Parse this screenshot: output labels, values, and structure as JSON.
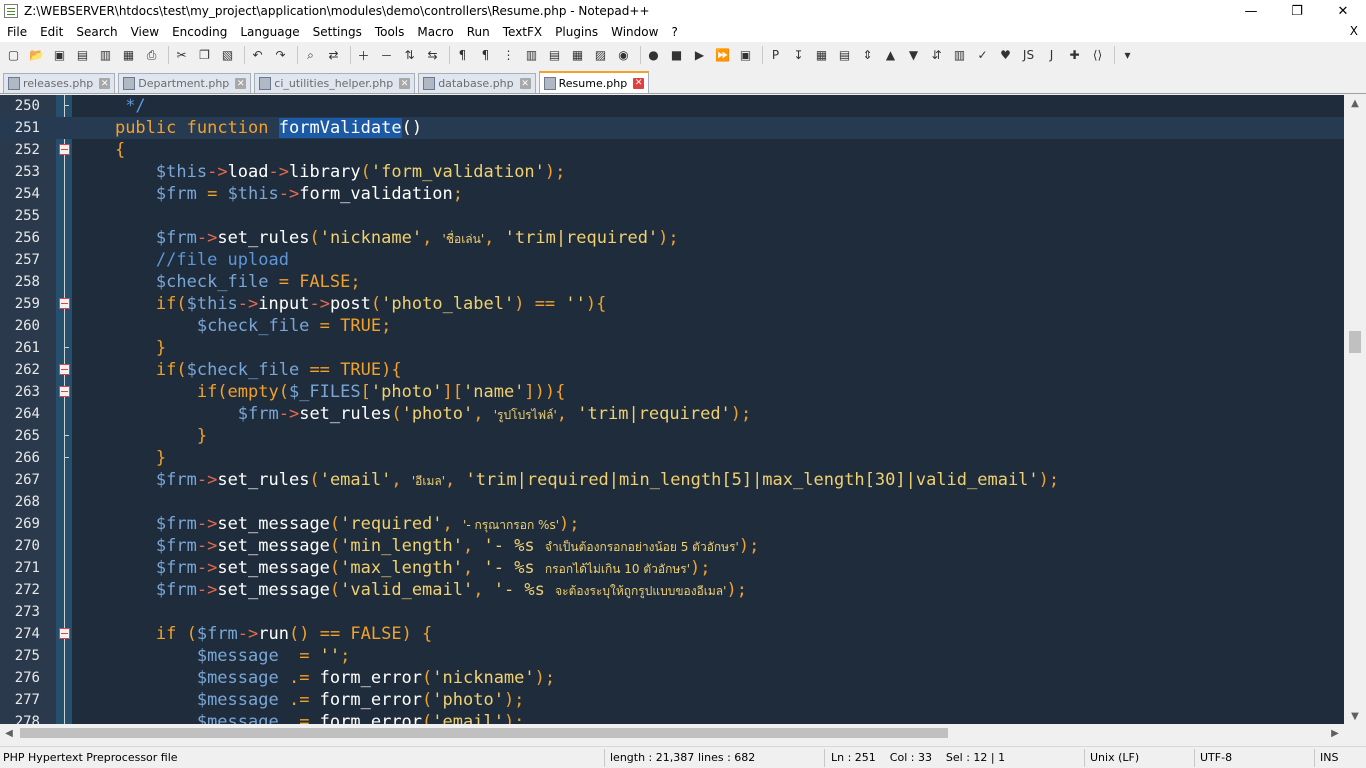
{
  "window": {
    "title": "Z:\\WEBSERVER\\htdocs\\test\\my_project\\application\\modules\\demo\\controllers\\Resume.php - Notepad++",
    "minimize": "—",
    "maximize": "❐",
    "close": "✕"
  },
  "menu": {
    "items": [
      "File",
      "Edit",
      "Search",
      "View",
      "Encoding",
      "Language",
      "Settings",
      "Tools",
      "Macro",
      "Run",
      "TextFX",
      "Plugins",
      "Window",
      "?"
    ],
    "close": "X"
  },
  "toolbar": {
    "icons": [
      "new-file-icon",
      "open-file-icon",
      "save-icon",
      "save-all-icon",
      "close-icon",
      "close-all-icon",
      "print-icon",
      "cut-icon",
      "copy-icon",
      "paste-icon",
      "undo-icon",
      "redo-icon",
      "find-icon",
      "replace-icon",
      "zoom-in-icon",
      "zoom-out-icon",
      "sync-vertical-icon",
      "sync-horizontal-icon",
      "word-wrap-icon",
      "show-all-chars-icon",
      "indent-guide-icon",
      "udl-icon",
      "doc-map-icon",
      "function-list-icon",
      "folder-workspace-icon",
      "monitor-icon",
      "record-macro-icon",
      "stop-record-icon",
      "play-macro-icon",
      "run-macro-multiple-icon",
      "save-macro-icon",
      "php-icon",
      "insert-icon",
      "table-icon",
      "list-icon",
      "sort-icon",
      "up-arrow-icon",
      "down-arrow-icon",
      "compare-icon",
      "split-icon",
      "spell-check-icon",
      "heart-icon",
      "js-icon",
      "json-icon",
      "plugin-icon",
      "xml-icon",
      "dropdown-icon"
    ],
    "glyphs": [
      "▢",
      "📂",
      "▣",
      "▤",
      "▥",
      "▦",
      "⎙",
      "✂",
      "❐",
      "▧",
      "↶",
      "↷",
      "⌕",
      "⇄",
      "＋",
      "－",
      "⇅",
      "⇆",
      "¶",
      "¶",
      "⋮",
      "▥",
      "▤",
      "▦",
      "▨",
      "◉",
      "●",
      "■",
      "▶",
      "⏩",
      "▣",
      "P",
      "↧",
      "▦",
      "▤",
      "⇕",
      "▲",
      "▼",
      "⇵",
      "▥",
      "✓",
      "♥",
      "JS",
      "J",
      "✚",
      "⟨⟩",
      "▾"
    ]
  },
  "tabs": [
    {
      "label": "releases.php",
      "active": false
    },
    {
      "label": "Department.php",
      "active": false
    },
    {
      "label": "ci_utilities_helper.php",
      "active": false
    },
    {
      "label": "database.php",
      "active": false
    },
    {
      "label": "Resume.php",
      "active": true
    }
  ],
  "tab_close_glyph": "✕",
  "editor": {
    "current_line": 251,
    "lines": [
      {
        "n": "250",
        "fold": "tick",
        "indent": "    ",
        "tokens": [
          [
            "cmt",
            " */"
          ]
        ]
      },
      {
        "n": "251",
        "fold": "none",
        "indent": "    ",
        "tokens": [
          [
            "kw",
            "public"
          ],
          [
            "",
            " "
          ],
          [
            "kw",
            "function"
          ],
          [
            "",
            " "
          ],
          [
            "hl",
            "formValidate"
          ],
          [
            "fn",
            "()"
          ]
        ]
      },
      {
        "n": "252",
        "fold": "box",
        "indent": "    ",
        "tokens": [
          [
            "kw",
            "{"
          ]
        ]
      },
      {
        "n": "253",
        "fold": "none",
        "indent": "        ",
        "tokens": [
          [
            "var",
            "$this"
          ],
          [
            "op",
            "->"
          ],
          [
            "fn",
            "load"
          ],
          [
            "op",
            "->"
          ],
          [
            "fn",
            "library"
          ],
          [
            "kw",
            "("
          ],
          [
            "str",
            "'form_validation'"
          ],
          [
            "kw",
            ");"
          ]
        ]
      },
      {
        "n": "254",
        "fold": "none",
        "indent": "        ",
        "tokens": [
          [
            "var",
            "$frm"
          ],
          [
            "kw",
            " = "
          ],
          [
            "var",
            "$this"
          ],
          [
            "op",
            "->"
          ],
          [
            "fn",
            "form_validation"
          ],
          [
            "kw",
            ";"
          ]
        ]
      },
      {
        "n": "255",
        "fold": "none",
        "indent": "",
        "tokens": []
      },
      {
        "n": "256",
        "fold": "none",
        "indent": "        ",
        "tokens": [
          [
            "var",
            "$frm"
          ],
          [
            "op",
            "->"
          ],
          [
            "fn",
            "set_rules"
          ],
          [
            "kw",
            "("
          ],
          [
            "str",
            "'nickname'"
          ],
          [
            "kw",
            ", "
          ],
          [
            "str thai",
            "'ชื่อเล่น'"
          ],
          [
            "kw",
            ", "
          ],
          [
            "str",
            "'trim|required'"
          ],
          [
            "kw",
            ");"
          ]
        ]
      },
      {
        "n": "257",
        "fold": "none",
        "indent": "        ",
        "tokens": [
          [
            "cmt",
            "//file upload"
          ]
        ]
      },
      {
        "n": "258",
        "fold": "none",
        "indent": "        ",
        "tokens": [
          [
            "var",
            "$check_file"
          ],
          [
            "kw",
            " = FALSE;"
          ]
        ]
      },
      {
        "n": "259",
        "fold": "box",
        "indent": "        ",
        "tokens": [
          [
            "kw",
            "if("
          ],
          [
            "var",
            "$this"
          ],
          [
            "op",
            "->"
          ],
          [
            "fn",
            "input"
          ],
          [
            "op",
            "->"
          ],
          [
            "fn",
            "post"
          ],
          [
            "kw",
            "("
          ],
          [
            "str",
            "'photo_label'"
          ],
          [
            "kw",
            ") == "
          ],
          [
            "str",
            "''"
          ],
          [
            "kw",
            "){"
          ]
        ]
      },
      {
        "n": "260",
        "fold": "none",
        "indent": "            ",
        "tokens": [
          [
            "var",
            "$check_file"
          ],
          [
            "kw",
            " = TRUE;"
          ]
        ]
      },
      {
        "n": "261",
        "fold": "tick",
        "indent": "        ",
        "tokens": [
          [
            "kw",
            "}"
          ]
        ]
      },
      {
        "n": "262",
        "fold": "box",
        "indent": "        ",
        "tokens": [
          [
            "kw",
            "if("
          ],
          [
            "var",
            "$check_file"
          ],
          [
            "kw",
            " == TRUE){"
          ]
        ]
      },
      {
        "n": "263",
        "fold": "box",
        "indent": "            ",
        "tokens": [
          [
            "kw",
            "if(empty("
          ],
          [
            "var",
            "$_FILES"
          ],
          [
            "kw",
            "["
          ],
          [
            "str",
            "'photo'"
          ],
          [
            "kw",
            "]["
          ],
          [
            "str",
            "'name'"
          ],
          [
            "kw",
            "])){"
          ]
        ]
      },
      {
        "n": "264",
        "fold": "none",
        "indent": "                ",
        "tokens": [
          [
            "var",
            "$frm"
          ],
          [
            "op",
            "->"
          ],
          [
            "fn",
            "set_rules"
          ],
          [
            "kw",
            "("
          ],
          [
            "str",
            "'photo'"
          ],
          [
            "kw",
            ", "
          ],
          [
            "str thai",
            "'รูปโปรไฟล์'"
          ],
          [
            "kw",
            ", "
          ],
          [
            "str",
            "'trim|required'"
          ],
          [
            "kw",
            ");"
          ]
        ]
      },
      {
        "n": "265",
        "fold": "tick",
        "indent": "            ",
        "tokens": [
          [
            "kw",
            "}"
          ]
        ]
      },
      {
        "n": "266",
        "fold": "tick",
        "indent": "        ",
        "tokens": [
          [
            "kw",
            "}"
          ]
        ]
      },
      {
        "n": "267",
        "fold": "none",
        "indent": "        ",
        "tokens": [
          [
            "var",
            "$frm"
          ],
          [
            "op",
            "->"
          ],
          [
            "fn",
            "set_rules"
          ],
          [
            "kw",
            "("
          ],
          [
            "str",
            "'email'"
          ],
          [
            "kw",
            ", "
          ],
          [
            "str thai",
            "'อีเมล'"
          ],
          [
            "kw",
            ", "
          ],
          [
            "str",
            "'trim|required|min_length[5]|max_length[30]|valid_email'"
          ],
          [
            "kw",
            ");"
          ]
        ]
      },
      {
        "n": "268",
        "fold": "none",
        "indent": "",
        "tokens": []
      },
      {
        "n": "269",
        "fold": "none",
        "indent": "        ",
        "tokens": [
          [
            "var",
            "$frm"
          ],
          [
            "op",
            "->"
          ],
          [
            "fn",
            "set_message"
          ],
          [
            "kw",
            "("
          ],
          [
            "str",
            "'required'"
          ],
          [
            "kw",
            ", "
          ],
          [
            "str thai",
            "'- กรุณากรอก %s'"
          ],
          [
            "kw",
            ");"
          ]
        ]
      },
      {
        "n": "270",
        "fold": "none",
        "indent": "        ",
        "tokens": [
          [
            "var",
            "$frm"
          ],
          [
            "op",
            "->"
          ],
          [
            "fn",
            "set_message"
          ],
          [
            "kw",
            "("
          ],
          [
            "str",
            "'min_length'"
          ],
          [
            "kw",
            ", "
          ],
          [
            "str",
            "'- %s "
          ],
          [
            "str thai",
            "จำเป็นต้องกรอกอย่างน้อย 5 ตัวอักษร'"
          ],
          [
            "kw",
            ");"
          ]
        ]
      },
      {
        "n": "271",
        "fold": "none",
        "indent": "        ",
        "tokens": [
          [
            "var",
            "$frm"
          ],
          [
            "op",
            "->"
          ],
          [
            "fn",
            "set_message"
          ],
          [
            "kw",
            "("
          ],
          [
            "str",
            "'max_length'"
          ],
          [
            "kw",
            ", "
          ],
          [
            "str",
            "'- %s "
          ],
          [
            "str thai",
            "กรอกได้ไม่เกิน 10 ตัวอักษร'"
          ],
          [
            "kw",
            ");"
          ]
        ]
      },
      {
        "n": "272",
        "fold": "none",
        "indent": "        ",
        "tokens": [
          [
            "var",
            "$frm"
          ],
          [
            "op",
            "->"
          ],
          [
            "fn",
            "set_message"
          ],
          [
            "kw",
            "("
          ],
          [
            "str",
            "'valid_email'"
          ],
          [
            "kw",
            ", "
          ],
          [
            "str",
            "'- %s "
          ],
          [
            "str thai",
            "จะต้องระบุให้ถูกรูปแบบของอีเมล'"
          ],
          [
            "kw",
            ");"
          ]
        ]
      },
      {
        "n": "273",
        "fold": "none",
        "indent": "",
        "tokens": []
      },
      {
        "n": "274",
        "fold": "box",
        "indent": "        ",
        "tokens": [
          [
            "kw",
            "if ("
          ],
          [
            "var",
            "$frm"
          ],
          [
            "op",
            "->"
          ],
          [
            "fn",
            "run"
          ],
          [
            "kw",
            "() == FALSE) {"
          ]
        ]
      },
      {
        "n": "275",
        "fold": "none",
        "indent": "            ",
        "tokens": [
          [
            "var",
            "$message"
          ],
          [
            "kw",
            "  = "
          ],
          [
            "str",
            "''"
          ],
          [
            "kw",
            ";"
          ]
        ]
      },
      {
        "n": "276",
        "fold": "none",
        "indent": "            ",
        "tokens": [
          [
            "var",
            "$message"
          ],
          [
            "kw",
            " .= "
          ],
          [
            "fn",
            "form_error"
          ],
          [
            "kw",
            "("
          ],
          [
            "str",
            "'nickname'"
          ],
          [
            "kw",
            ");"
          ]
        ]
      },
      {
        "n": "277",
        "fold": "none",
        "indent": "            ",
        "tokens": [
          [
            "var",
            "$message"
          ],
          [
            "kw",
            " .= "
          ],
          [
            "fn",
            "form_error"
          ],
          [
            "kw",
            "("
          ],
          [
            "str",
            "'photo'"
          ],
          [
            "kw",
            ");"
          ]
        ]
      },
      {
        "n": "278",
        "fold": "none",
        "indent": "            ",
        "tokens": [
          [
            "var",
            "$message"
          ],
          [
            "kw",
            " .= "
          ],
          [
            "fn",
            "form_error"
          ],
          [
            "kw",
            "("
          ],
          [
            "str",
            "'email'"
          ],
          [
            "kw",
            ");"
          ]
        ]
      }
    ]
  },
  "scroll": {
    "up": "▲",
    "down": "▼",
    "left": "◀",
    "right": "▶"
  },
  "status": {
    "file_type": "PHP Hypertext Preprocessor file",
    "length": "length : 21,387",
    "lines": "lines : 682",
    "position": "Ln : 251    Col : 33    Sel : 12 | 1",
    "eol": "Unix (LF)",
    "encoding": "UTF-8",
    "mode": "INS"
  },
  "colors": {
    "editor_bg": "#1e2c3c",
    "keyword": "#f2a12a",
    "variable": "#7aa6d6",
    "string": "#f0d070",
    "comment": "#5d97d9",
    "operator": "#e86a4a",
    "selection": "#1c5aa6"
  }
}
